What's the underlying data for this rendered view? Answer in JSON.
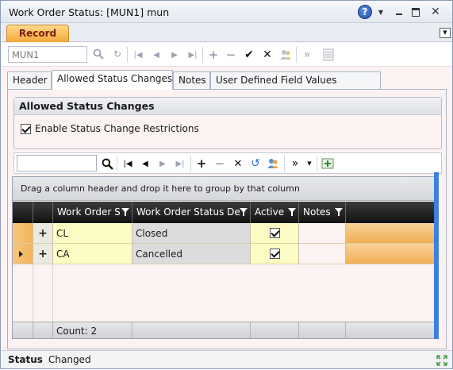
{
  "window": {
    "title": "Work Order Status: [MUN1] mun",
    "help_symbol": "?",
    "close_symbol": "✕"
  },
  "ribbon": {
    "tab_label": "Record"
  },
  "record_toolbar": {
    "record_input_value": "MUN1"
  },
  "tabs": [
    {
      "label": "Header"
    },
    {
      "label": "Allowed Status Changes"
    },
    {
      "label": "Notes"
    },
    {
      "label": "User Defined Field Values"
    }
  ],
  "allowed_status_changes": {
    "group_title": "Allowed Status Changes",
    "enable_label": "Enable Status Change Restrictions",
    "enable_checked": true
  },
  "grid": {
    "group_hint": "Drag a column header and drop it here to group by that column",
    "columns": [
      "Work Order S",
      "Work Order Status De",
      "Active",
      "Notes"
    ],
    "rows": [
      {
        "code": "CL",
        "description": "Closed",
        "active": true,
        "notes": ""
      },
      {
        "code": "CA",
        "description": "Cancelled",
        "active": true,
        "notes": ""
      }
    ],
    "footer_count": "Count: 2"
  },
  "status": {
    "label": "Status",
    "value": "Changed"
  },
  "colors": {
    "accent_orange": "#f3a93a",
    "row_yellow": "#fdfbc4",
    "header_dark": "#1e1e1e",
    "scroll_blue": "#3b7fe0"
  },
  "icons": [
    "help-icon",
    "search-icon",
    "refresh-icon",
    "first-record-icon",
    "previous-record-icon",
    "next-record-icon",
    "last-record-icon",
    "add-icon",
    "remove-icon",
    "save-check-icon",
    "cancel-x-icon",
    "users-icon",
    "more-chevron-icon",
    "notes-icon",
    "undo-icon",
    "add-row-icon",
    "filter-icon",
    "expand-plus-icon",
    "resize-grip-icon"
  ]
}
